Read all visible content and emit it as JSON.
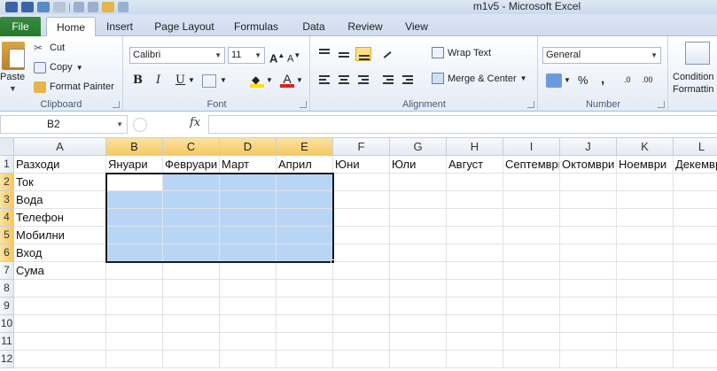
{
  "window": {
    "title": "m1v5  -  Microsoft Excel"
  },
  "tabs": {
    "file": "File",
    "items": [
      "Home",
      "Insert",
      "Page Layout",
      "Formulas",
      "Data",
      "Review",
      "View"
    ],
    "active": "Home"
  },
  "ribbon": {
    "clipboard": {
      "paste": "Paste",
      "cut": "Cut",
      "copy": "Copy",
      "format_painter": "Format Painter",
      "label": "Clipboard"
    },
    "font": {
      "name": "Calibri",
      "size": "11",
      "grow": "A",
      "shrink": "A",
      "bold": "B",
      "italic": "I",
      "underline": "U",
      "label": "Font",
      "font_color_letter": "A"
    },
    "alignment": {
      "wrap_text": "Wrap Text",
      "merge_center": "Merge & Center",
      "label": "Alignment"
    },
    "number": {
      "format": "General",
      "percent": "%",
      "comma": ",",
      "inc_decimal": ".0",
      "dec_decimal": ".00",
      "label": "Number"
    },
    "styles": {
      "conditional": "Condition",
      "formatting": "Formattin"
    }
  },
  "formula_bar": {
    "name_box": "B2",
    "fx": "fx",
    "value": ""
  },
  "sheet": {
    "columns": [
      "A",
      "B",
      "C",
      "D",
      "E",
      "F",
      "G",
      "H",
      "I",
      "J",
      "K",
      "L"
    ],
    "rows": [
      "1",
      "2",
      "3",
      "4",
      "5",
      "6",
      "7",
      "8",
      "9",
      "10",
      "11",
      "12"
    ],
    "header_row": [
      "Разходи",
      "Януари",
      "Февруари",
      "Март",
      "Април",
      "Юни",
      "Юли",
      "Август",
      "Септември",
      "Октомври",
      "Ноември",
      "Декември"
    ],
    "col_a": [
      "Ток",
      "Вода",
      "Телефон",
      "Мобилни",
      "Вход",
      "Сума"
    ],
    "selection": "B2:E6",
    "active_cell": "B2"
  },
  "colors": {
    "selection_fill": "#b8d5f5",
    "header_highlight": "#f6c862",
    "file_tab": "#217a2b"
  }
}
